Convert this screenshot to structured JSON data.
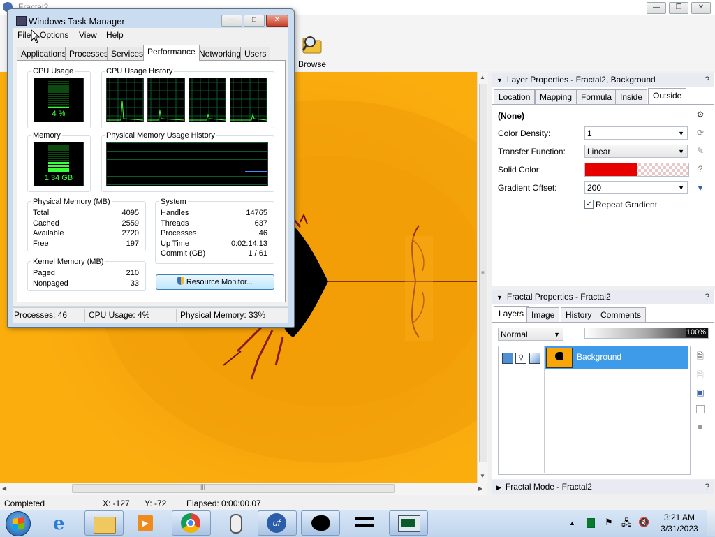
{
  "app": {
    "title": "Fractal2",
    "browse_label": "Browse",
    "layer_properties": {
      "header": "Layer Properties - Fractal2, Background",
      "tabs": [
        "Location",
        "Mapping",
        "Formula",
        "Inside",
        "Outside"
      ],
      "active_tab": "Outside",
      "coloring_name": "(None)",
      "color_density_label": "Color Density:",
      "color_density_value": "1",
      "transfer_function_label": "Transfer Function:",
      "transfer_function_value": "Linear",
      "solid_color_label": "Solid Color:",
      "solid_color_value": "#e60000",
      "gradient_offset_label": "Gradient Offset:",
      "gradient_offset_value": "200",
      "repeat_gradient_label": "Repeat Gradient",
      "repeat_gradient_checked": true,
      "help": "?"
    },
    "fractal_properties": {
      "header": "Fractal Properties - Fractal2",
      "tabs": [
        "Layers",
        "Image",
        "History",
        "Comments"
      ],
      "active_tab": "Layers",
      "blend_mode": "Normal",
      "opacity": "100%",
      "layer_name": "Background",
      "help": "?"
    },
    "fractal_mode": {
      "header": "Fractal Mode - Fractal2",
      "help": "?"
    },
    "status": {
      "state": "Completed",
      "x": "X: -127",
      "y": "Y: -72",
      "elapsed": "Elapsed: 0:00:00.07"
    },
    "colors": {
      "fractal_bg": "#f7a508",
      "fractal_dark": "#000000",
      "fractal_edge": "#8a1a1a"
    }
  },
  "taskmgr": {
    "title": "Windows Task Manager",
    "menu": [
      "File",
      "Options",
      "View",
      "Help"
    ],
    "tabs": [
      "Applications",
      "Processes",
      "Services",
      "Performance",
      "Networking",
      "Users"
    ],
    "active_tab": "Performance",
    "cpu_usage_label": "CPU Usage",
    "cpu_usage_value": "4 %",
    "cpu_history_label": "CPU Usage History",
    "memory_label": "Memory",
    "memory_value": "1.34 GB",
    "mem_history_label": "Physical Memory Usage History",
    "physical_memory": {
      "title": "Physical Memory (MB)",
      "rows": [
        [
          "Total",
          "4095"
        ],
        [
          "Cached",
          "2559"
        ],
        [
          "Available",
          "2720"
        ],
        [
          "Free",
          "197"
        ]
      ]
    },
    "system": {
      "title": "System",
      "rows": [
        [
          "Handles",
          "14765"
        ],
        [
          "Threads",
          "637"
        ],
        [
          "Processes",
          "46"
        ],
        [
          "Up Time",
          "0:02:14:13"
        ],
        [
          "Commit (GB)",
          "1 / 61"
        ]
      ]
    },
    "kernel_memory": {
      "title": "Kernel Memory (MB)",
      "rows": [
        [
          "Paged",
          "210"
        ],
        [
          "Nonpaged",
          "33"
        ]
      ]
    },
    "resource_monitor_label": "Resource Monitor...",
    "status": {
      "processes": "Processes: 46",
      "cpu": "CPU Usage: 4%",
      "memory": "Physical Memory: 33%"
    }
  },
  "taskbar": {
    "time": "3:21 AM",
    "date": "3/31/2023"
  }
}
